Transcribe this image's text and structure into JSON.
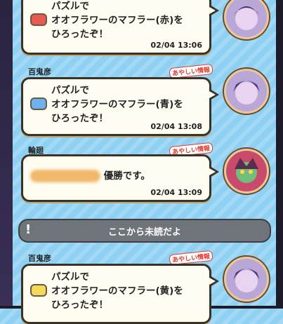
{
  "messages": [
    {
      "sender": "",
      "badge": "",
      "lines": [
        "パズルで",
        "オオフラワーのマフラー(赤)を",
        "ひろったぞ！"
      ],
      "timestamp": "02/04 13:06",
      "gem_color": "red"
    },
    {
      "sender": "百鬼彦",
      "badge": "あやしい情報",
      "lines": [
        "パズルで",
        "オオフラワーのマフラー(青)を",
        "ひろったぞ！"
      ],
      "timestamp": "02/04 13:08",
      "gem_color": "blue"
    },
    {
      "sender": "輪廻",
      "badge": "あやしい情報",
      "lines": [
        "優勝です。"
      ],
      "timestamp": "02/04 13:09",
      "gem_color": ""
    },
    {
      "sender": "百鬼彦",
      "badge": "あやしい情報",
      "lines": [
        "パズルで",
        "オオフラワーのマフラー(黄)を",
        "ひろったぞ！"
      ],
      "timestamp": "",
      "gem_color": "yellow"
    }
  ],
  "divider": {
    "text": "ここから未読だよ",
    "icon": "exclamation-icon"
  },
  "colors": {
    "background": "#8fd1f3",
    "bubble": "#fffdf2",
    "divider": "#6f737a"
  }
}
